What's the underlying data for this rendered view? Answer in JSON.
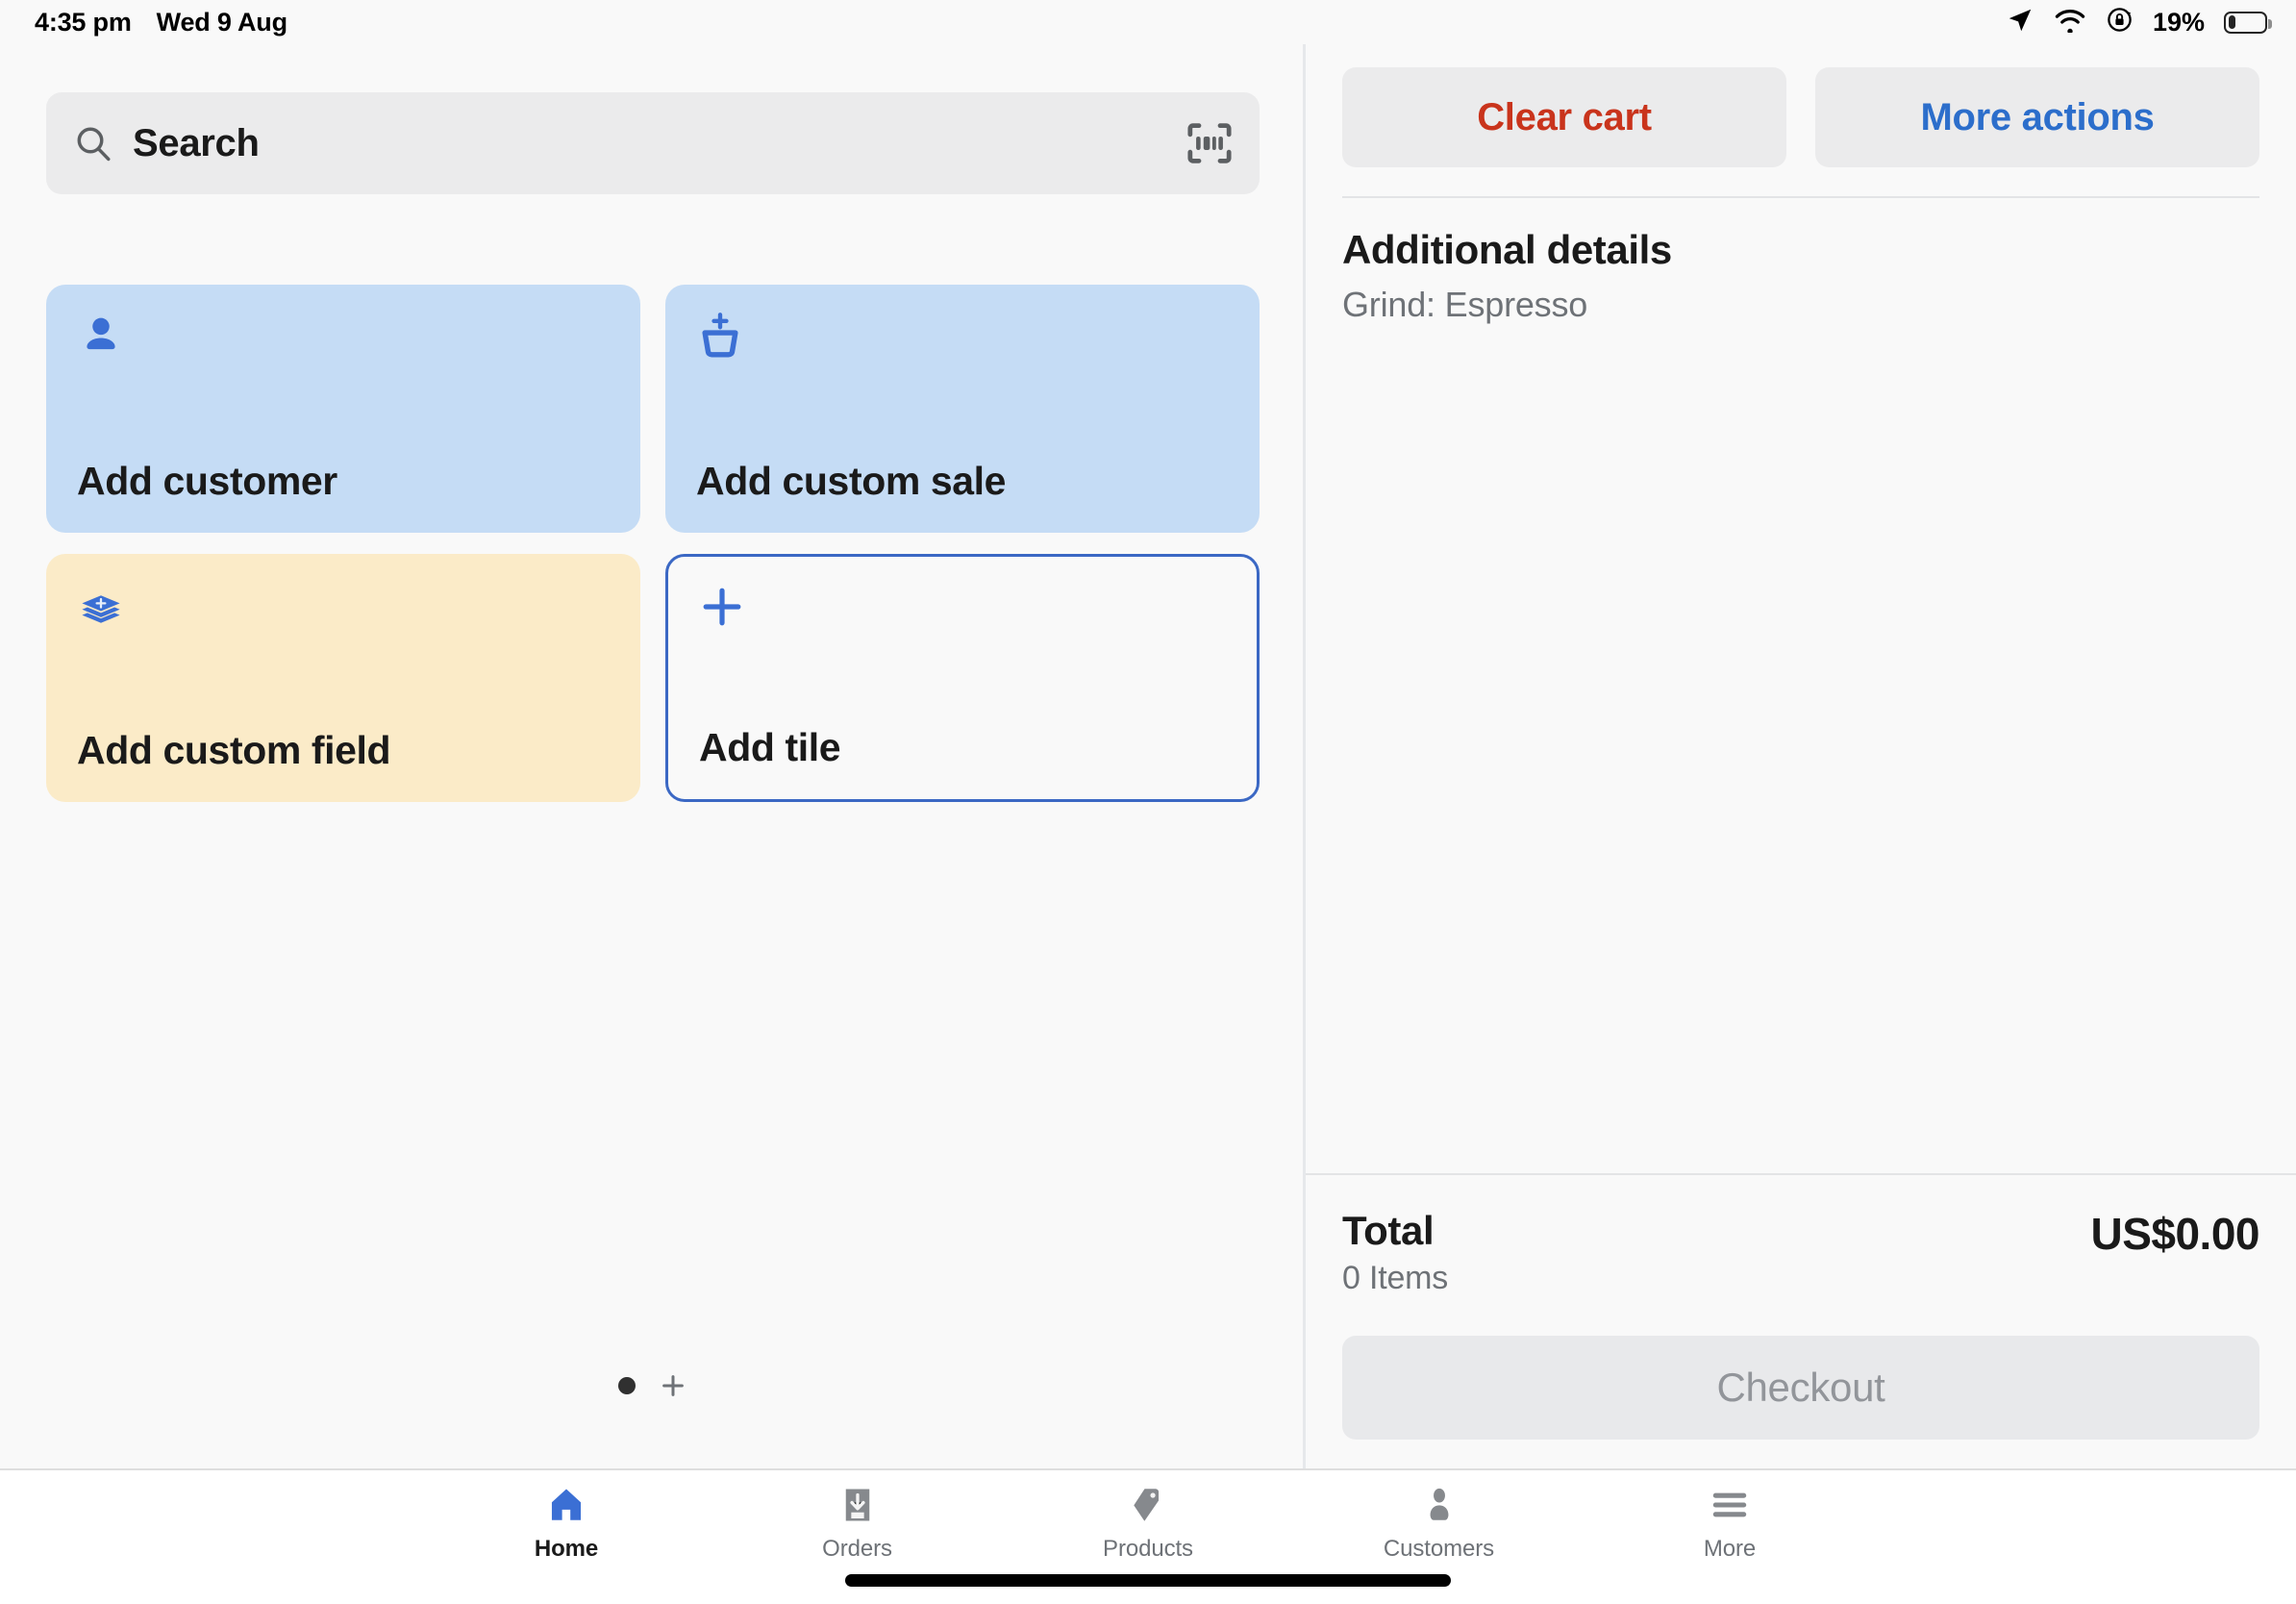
{
  "statusbar": {
    "time": "4:35 pm",
    "date": "Wed 9 Aug",
    "battery_percent": "19%",
    "icons": [
      "location-arrow-icon",
      "wifi-icon",
      "rotation-lock-icon",
      "battery-icon"
    ]
  },
  "search": {
    "placeholder": "Search",
    "scan_icon": "barcode-scan-icon"
  },
  "tiles": [
    {
      "label": "Add customer",
      "icon": "person-icon",
      "style": "blue"
    },
    {
      "label": "Add custom sale",
      "icon": "add-to-basket-icon",
      "style": "blue"
    },
    {
      "label": "Add custom field",
      "icon": "layers-plus-icon",
      "style": "yellow"
    },
    {
      "label": "Add tile",
      "icon": "plus-icon",
      "style": "outline"
    }
  ],
  "pager": {
    "current_page": 1,
    "total_pages": 1,
    "add_page_icon": "plus-icon"
  },
  "cart": {
    "clear_label": "Clear cart",
    "more_label": "More actions",
    "details_title": "Additional details",
    "details_lines": [
      "Grind: Espresso"
    ],
    "total_label": "Total",
    "items_label": "0 Items",
    "total_amount": "US$0.00",
    "checkout_label": "Checkout"
  },
  "tabbar": {
    "items": [
      {
        "label": "Home",
        "icon": "home-icon",
        "active": true
      },
      {
        "label": "Orders",
        "icon": "orders-icon",
        "active": false
      },
      {
        "label": "Products",
        "icon": "tag-icon",
        "active": false
      },
      {
        "label": "Customers",
        "icon": "person-icon",
        "active": false
      },
      {
        "label": "More",
        "icon": "menu-icon",
        "active": false
      }
    ]
  },
  "colors": {
    "accent_blue": "#2C6ECB",
    "destructive_red": "#C9341C",
    "tile_blue": "#C5DCF5",
    "tile_yellow": "#FBEBC8",
    "background": "#F9F9F9"
  }
}
